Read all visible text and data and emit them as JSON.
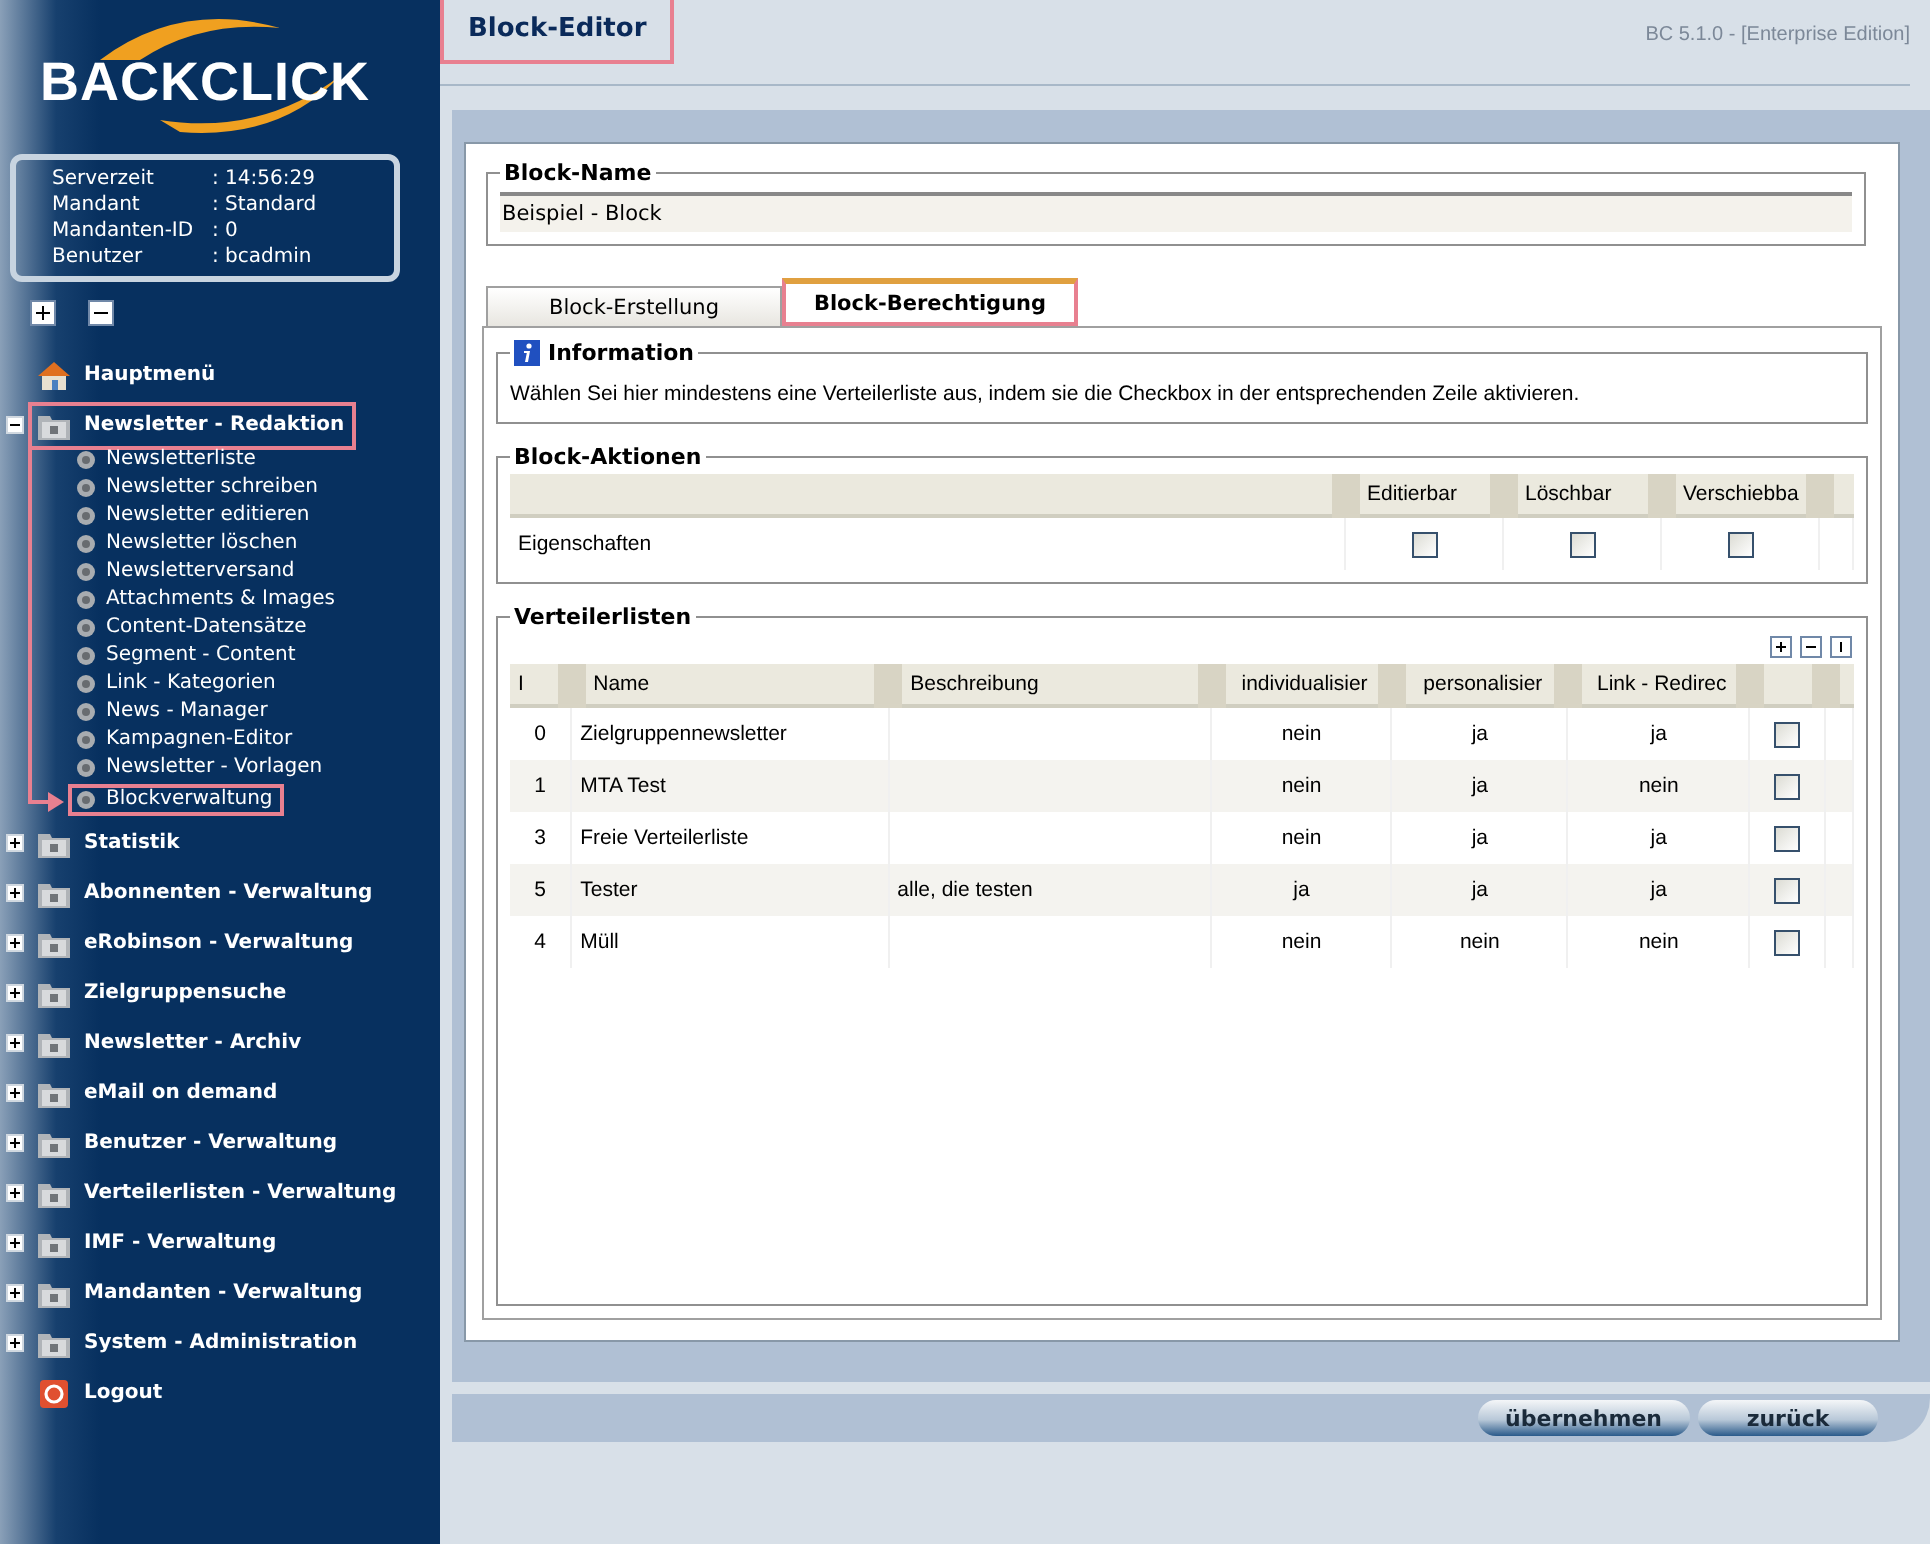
{
  "sidebar": {
    "logo": "BACKCLICK",
    "info": [
      {
        "label": "Serverzeit",
        "value": ": 14:56:29"
      },
      {
        "label": "Mandant",
        "value": ": Standard"
      },
      {
        "label": "Mandanten-ID",
        "value": ": 0"
      },
      {
        "label": "Benutzer",
        "value": ": bcadmin"
      }
    ],
    "menu": [
      {
        "kind": "home",
        "label": "Hauptmenü",
        "highlighted": false
      },
      {
        "kind": "folder",
        "label": "Newsletter - Redaktion",
        "expanded": true,
        "highlighted": true,
        "children": [
          {
            "label": "Newsletterliste",
            "highlighted": false
          },
          {
            "label": "Newsletter schreiben",
            "highlighted": false
          },
          {
            "label": "Newsletter editieren",
            "highlighted": false
          },
          {
            "label": "Newsletter löschen",
            "highlighted": false
          },
          {
            "label": "Newsletterversand",
            "highlighted": false
          },
          {
            "label": "Attachments & Images",
            "highlighted": false
          },
          {
            "label": "Content-Datensätze",
            "highlighted": false
          },
          {
            "label": "Segment - Content",
            "highlighted": false
          },
          {
            "label": "Link - Kategorien",
            "highlighted": false
          },
          {
            "label": "News - Manager",
            "highlighted": false
          },
          {
            "label": "Kampagnen-Editor",
            "highlighted": false
          },
          {
            "label": "Newsletter - Vorlagen",
            "highlighted": false
          },
          {
            "label": "Blockverwaltung",
            "highlighted": true
          }
        ]
      },
      {
        "kind": "folder",
        "label": "Statistik",
        "expanded": false,
        "highlighted": false
      },
      {
        "kind": "folder",
        "label": "Abonnenten - Verwaltung",
        "expanded": false,
        "highlighted": false
      },
      {
        "kind": "folder",
        "label": "eRobinson - Verwaltung",
        "expanded": false,
        "highlighted": false
      },
      {
        "kind": "folder",
        "label": "Zielgruppensuche",
        "expanded": false,
        "highlighted": false
      },
      {
        "kind": "folder",
        "label": "Newsletter - Archiv",
        "expanded": false,
        "highlighted": false
      },
      {
        "kind": "folder",
        "label": "eMail on demand",
        "expanded": false,
        "highlighted": false
      },
      {
        "kind": "folder",
        "label": "Benutzer - Verwaltung",
        "expanded": false,
        "highlighted": false
      },
      {
        "kind": "folder",
        "label": "Verteilerlisten - Verwaltung",
        "expanded": false,
        "highlighted": false
      },
      {
        "kind": "folder",
        "label": "IMF - Verwaltung",
        "expanded": false,
        "highlighted": false
      },
      {
        "kind": "folder",
        "label": "Mandanten - Verwaltung",
        "expanded": false,
        "highlighted": false
      },
      {
        "kind": "folder",
        "label": "System - Administration",
        "expanded": false,
        "highlighted": false
      },
      {
        "kind": "logout",
        "label": "Logout",
        "highlighted": false
      }
    ]
  },
  "header": {
    "title": "Block-Editor",
    "version": "BC 5.1.0 - [Enterprise Edition]"
  },
  "block_name": {
    "legend": "Block-Name",
    "value": "Beispiel - Block"
  },
  "tabs": [
    {
      "label": "Block-Erstellung",
      "selected": false
    },
    {
      "label": "Block-Berechtigung",
      "selected": true
    }
  ],
  "information": {
    "legend": "Information",
    "text": "Wählen Sei hier mindestens eine Verteilerliste aus, indem sie die Checkbox in der entsprechenden Zeile aktivieren."
  },
  "block_actions": {
    "legend": "Block-Aktionen",
    "columns": [
      "Editierbar",
      "Löschbar",
      "Verschiebba"
    ],
    "rows": [
      {
        "label": "Eigenschaften",
        "checks": [
          false,
          false,
          false
        ]
      }
    ]
  },
  "distribution_lists": {
    "legend": "Verteilerlisten",
    "columns": [
      "I",
      "Name",
      "Beschreibung",
      "individualisier",
      "personalisier",
      "Link - Redirec"
    ],
    "rows": [
      {
        "id": "0",
        "name": "Zielgruppennewsletter",
        "individualized": "nein",
        "personalized": "ja",
        "link_redirect": "ja",
        "checked": false
      },
      {
        "id": "1",
        "name": "MTA Test",
        "individualized": "nein",
        "personalized": "ja",
        "link_redirect": "nein",
        "checked": false
      },
      {
        "id": "3",
        "name": "Freie Verteilerliste",
        "individualized": "nein",
        "personalized": "ja",
        "link_redirect": "ja",
        "checked": false
      },
      {
        "id": "5",
        "name": "Tester",
        "description": "alle, die testen",
        "individualized": "ja",
        "personalized": "ja",
        "link_redirect": "ja",
        "checked": false
      },
      {
        "id": "4",
        "name": "Müll",
        "individualized": "nein",
        "personalized": "nein",
        "link_redirect": "nein",
        "checked": false
      }
    ]
  },
  "buttons": [
    "übernehmen",
    "zurück"
  ]
}
